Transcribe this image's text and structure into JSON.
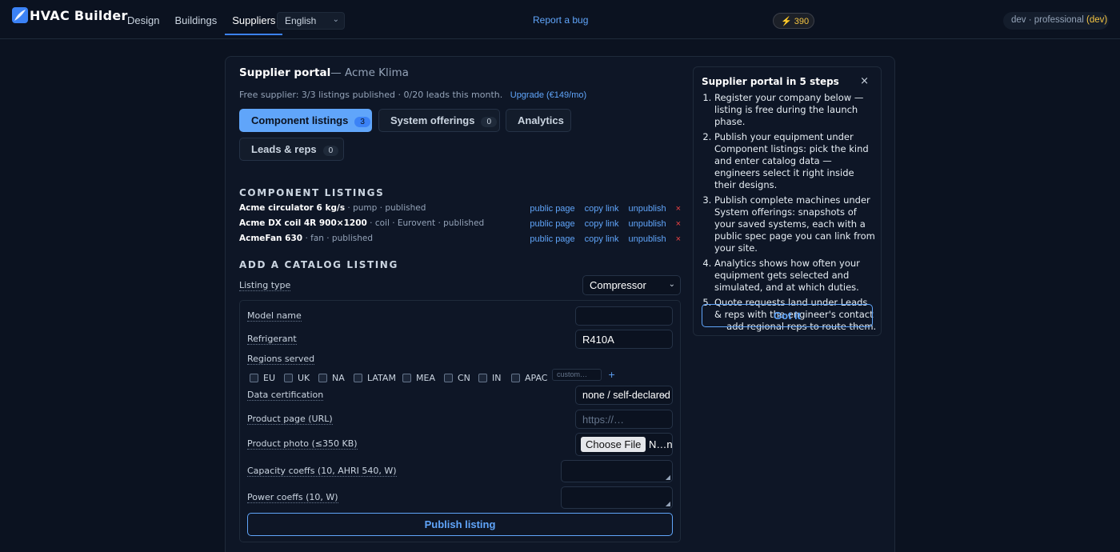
{
  "app": {
    "name": "HVAC Builder",
    "icon": "leaf-logo-icon"
  },
  "nav": {
    "items": [
      {
        "label": "Design"
      },
      {
        "label": "Buildings"
      },
      {
        "label": "Suppliers",
        "active": true
      }
    ],
    "language": "English",
    "report_bug": "Report a bug",
    "credits": "⚡ 390",
    "user": {
      "env": "dev · professional",
      "tier": "(dev)"
    }
  },
  "portal": {
    "title": "Supplier portal",
    "company": "— Acme Klima",
    "plan_text": "Free supplier: 3/3 listings published · 0/20 leads this month.",
    "upgrade_label": "Upgrade (€149/mo)",
    "tabs": [
      {
        "label": "Component listings",
        "count": "3",
        "active": true
      },
      {
        "label": "System offerings",
        "count": "0"
      },
      {
        "label": "Analytics"
      },
      {
        "label": "Leads & reps",
        "count": "0"
      }
    ],
    "listings_heading": "COMPONENT LISTINGS",
    "listings": [
      {
        "name": "Acme circulator 6 kg/s",
        "meta": " · pump · published"
      },
      {
        "name": "Acme DX coil 4R 900×1200",
        "meta": " · coil · Eurovent · published"
      },
      {
        "name": "AcmeFan 630",
        "meta": " · fan · published"
      }
    ],
    "actions": {
      "public_page": "public page",
      "copy_link": "copy link",
      "unpublish": "unpublish",
      "remove": "×"
    },
    "add_heading": "ADD A CATALOG LISTING",
    "form": {
      "listing_type_label": "Listing type",
      "listing_type_value": "Compressor",
      "model_name_label": "Model name",
      "model_name_value": "",
      "refrigerant_label": "Refrigerant",
      "refrigerant_value": "R410A",
      "regions_label": "Regions served",
      "regions": [
        "EU",
        "UK",
        "NA",
        "LATAM",
        "MEA",
        "CN",
        "IN",
        "APAC"
      ],
      "custom_placeholder": "custom…",
      "add_region": "+",
      "certification_label": "Data certification",
      "certification_value": "none / self-declared",
      "product_page_label": "Product page (URL)",
      "product_page_placeholder": "https://…",
      "photo_label": "Product photo (≤350 KB)",
      "choose_file": "Choose File",
      "no_file": "N…n",
      "capacity_label": "Capacity coeffs (10, AHRI 540, W)",
      "power_label": "Power coeffs (10, W)",
      "publish_label": "Publish listing"
    }
  },
  "steps": {
    "title": "Supplier portal in 5 steps",
    "close": "×",
    "items": [
      "Register your company below — listing is free during the launch phase.",
      "Publish your equipment under Component listings: pick the kind and enter catalog data — engineers select it right inside their designs.",
      "Publish complete machines under System offerings: snapshots of your saved systems, each with a public spec page you can link from your site.",
      "Analytics shows how often your equipment gets selected and simulated, and at which duties.",
      "Quote requests land under Leads & reps with the engineer's contact — add regional reps to route them."
    ],
    "got_it": "Got it"
  },
  "colors": {
    "background": "#0b1220",
    "accent": "#60a5fa",
    "danger": "#ef4444",
    "credits": "#f5c542"
  }
}
